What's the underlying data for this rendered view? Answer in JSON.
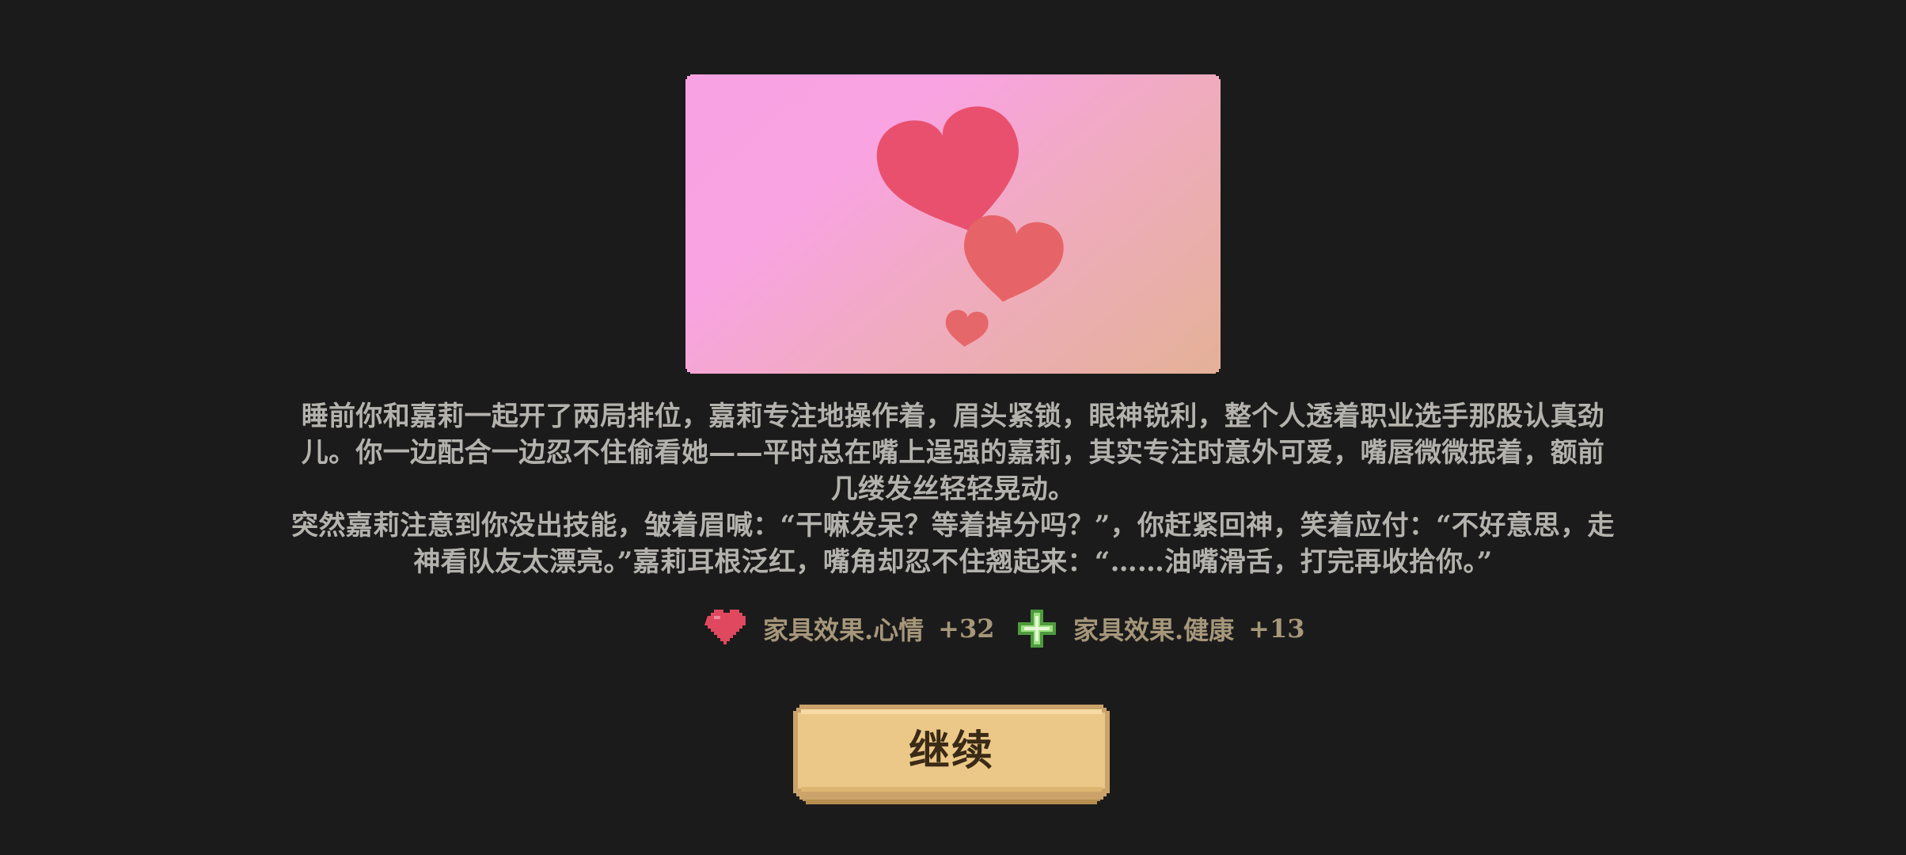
{
  "story": {
    "paragraph1": "睡前你和嘉莉一起开了两局排位，嘉莉专注地操作着，眉头紧锁，眼神锐利，整个人透着职业选手那股认真劲儿。你一边配合一边忍不住偷看她——平时总在嘴上逞强的嘉莉，其实专注时意外可爱，嘴唇微微抿着，额前几缕发丝轻轻晃动。",
    "paragraph2": "突然嘉莉注意到你没出技能，皱着眉喊：“干嘛发呆？等着掉分吗？”，你赶紧回神，笑着应付：“不好意思，走神看队友太漂亮。”嘉莉耳根泛红，嘴角却忍不住翘起来：“……油嘴滑舌，打完再收拾你。”"
  },
  "effects": [
    {
      "icon": "heart-icon",
      "label": "家具效果.心情",
      "value": "+32",
      "color": "#e0485f"
    },
    {
      "icon": "health-plus-icon",
      "label": "家具效果.健康",
      "value": "+13",
      "color": "#7ec86a"
    }
  ],
  "continue_button": {
    "label": "继续"
  },
  "colors": {
    "background": "#1b1b1b",
    "story_text": "#b4b2ad",
    "effect_text": "#a6977a",
    "button_face": "#ebc887",
    "button_text": "#3a2a16"
  }
}
